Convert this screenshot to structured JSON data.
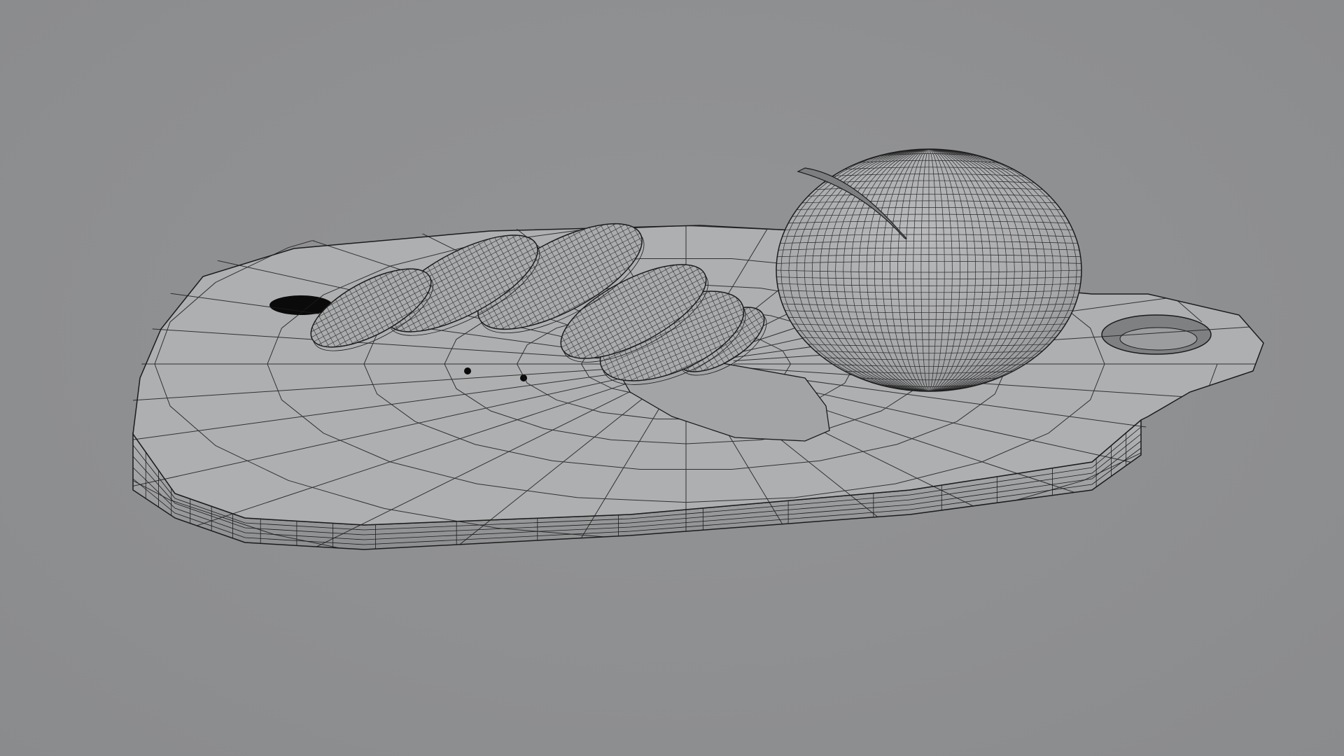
{
  "scene": {
    "render_mode": "wireframe-on-shaded",
    "background_color": "#8f9092",
    "surface_color": "#a9aaac",
    "wire_color": "#1b1b1b",
    "objects": [
      {
        "name": "cutting-board",
        "icon": "board-icon"
      },
      {
        "name": "onion-half",
        "icon": "sphere-icon"
      },
      {
        "name": "onion-slices",
        "count": 6,
        "icon": "slice-icon"
      }
    ]
  }
}
